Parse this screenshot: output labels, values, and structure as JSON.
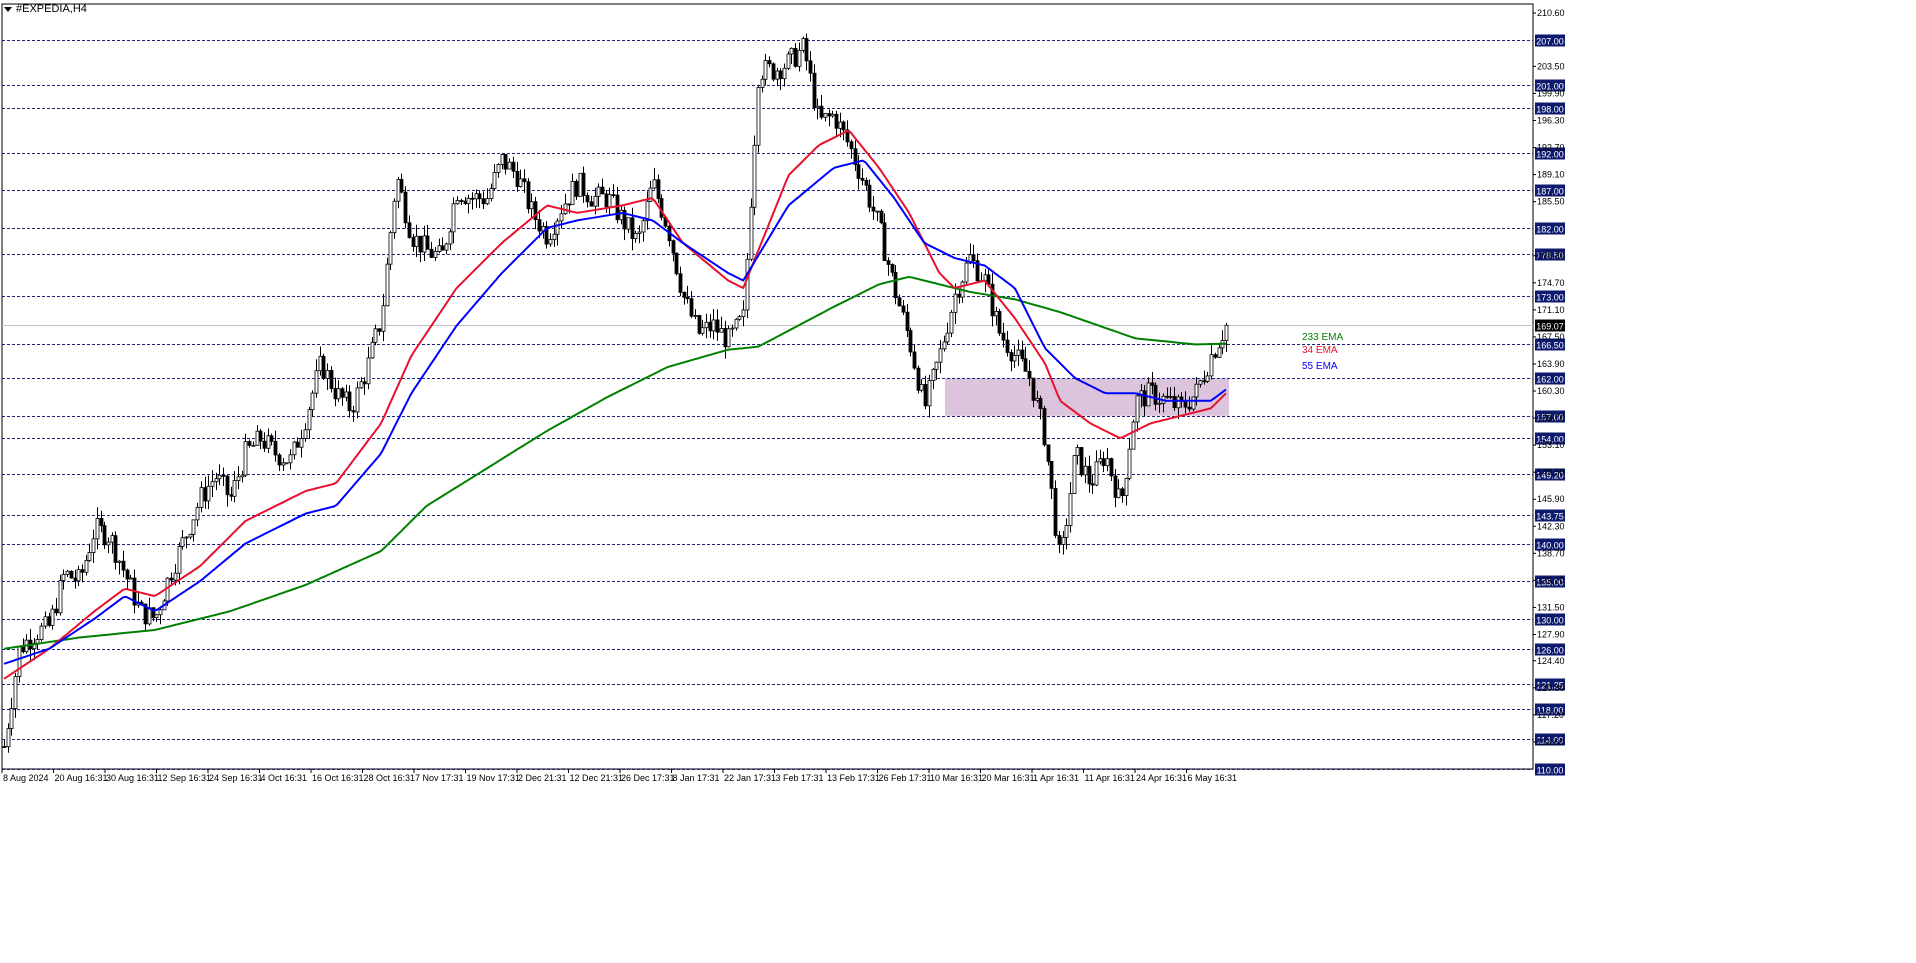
{
  "title": "#EXPEDIA,H4",
  "colors": {
    "background": "#ffffff",
    "candle": "#000000",
    "grid_dashed": "#1a237e",
    "level_tag_bg": "#0d1a6e",
    "level_tag_text": "#ffffff",
    "ema233": "#008000",
    "ema34": "#e8112d",
    "ema55": "#0000ff",
    "zone": "#d8bfd8",
    "current_line": "#c0c0c0"
  },
  "chart_data": {
    "type": "candlestick",
    "symbol": "#EXPEDIA",
    "timeframe": "H4",
    "ylim": [
      110.0,
      211.8
    ],
    "x_ticks": [
      "8 Aug 2024",
      "20 Aug 16:31",
      "30 Aug 16:31",
      "12 Sep 16:31",
      "24 Sep 16:31",
      "4 Oct 16:31",
      "16 Oct 16:31",
      "28 Oct 16:31",
      "7 Nov 17:31",
      "19 Nov 17:31",
      "2 Dec 21:31",
      "12 Dec 21:31",
      "26 Dec 17:31",
      "8 Jan 17:31",
      "22 Jan 17:31",
      "3 Feb 17:31",
      "13 Feb 17:31",
      "26 Feb 17:31",
      "10 Mar 16:31",
      "20 Mar 16:31",
      "1 Apr 16:31",
      "11 Apr 16:31",
      "24 Apr 16:31",
      "6 May 16:31"
    ],
    "y_scale_ticks": [
      "210.60",
      "203.50",
      "199.90",
      "196.30",
      "192.70",
      "189.10",
      "185.50",
      "178.30",
      "174.70",
      "171.10",
      "167.50",
      "163.90",
      "160.30",
      "156.70",
      "153.10",
      "149.50",
      "145.90",
      "142.30",
      "138.70",
      "135.10",
      "131.50",
      "127.90",
      "124.40",
      "120.80",
      "117.20",
      "113.60"
    ],
    "levels": [
      "207.00",
      "201.00",
      "198.00",
      "192.00",
      "187.00",
      "182.00",
      "178.50",
      "173.00",
      "166.50",
      "162.00",
      "157.00",
      "154.00",
      "149.20",
      "143.75",
      "140.00",
      "135.00",
      "130.00",
      "126.00",
      "121.25",
      "118.00",
      "114.00",
      "110.00"
    ],
    "current_price": "169.07",
    "support_zone": {
      "low": 157.0,
      "high": 162.0,
      "x_start": "10 Mar 16:31",
      "x_end": "6 May 16:31"
    },
    "legend": [
      {
        "name": "233 EMA",
        "color": "#008000"
      },
      {
        "name": "34 EMA",
        "color": "#e8112d"
      },
      {
        "name": "55 EMA",
        "color": "#0000ff"
      }
    ],
    "price_path": [
      [
        0,
        113
      ],
      [
        1,
        126
      ],
      [
        2,
        128
      ],
      [
        3,
        129
      ],
      [
        4,
        136
      ],
      [
        5,
        135
      ],
      [
        6,
        142
      ],
      [
        7,
        141
      ],
      [
        8,
        136
      ],
      [
        9,
        131
      ],
      [
        10,
        130
      ],
      [
        11,
        136
      ],
      [
        12,
        141
      ],
      [
        13,
        146
      ],
      [
        14,
        149
      ],
      [
        15,
        146
      ],
      [
        16,
        152
      ],
      [
        17,
        154
      ],
      [
        18,
        152
      ],
      [
        19,
        151
      ],
      [
        20,
        157
      ],
      [
        21,
        164
      ],
      [
        22,
        160
      ],
      [
        23,
        158
      ],
      [
        24,
        163
      ],
      [
        25,
        170
      ],
      [
        26,
        189
      ],
      [
        27,
        181
      ],
      [
        28,
        179
      ],
      [
        29,
        178
      ],
      [
        30,
        187
      ],
      [
        31,
        186
      ],
      [
        32,
        186
      ],
      [
        33,
        191
      ],
      [
        34,
        189
      ],
      [
        35,
        184
      ],
      [
        36,
        181
      ],
      [
        37,
        185
      ],
      [
        38,
        188
      ],
      [
        39,
        186
      ],
      [
        40,
        186
      ],
      [
        41,
        183
      ],
      [
        42,
        180
      ],
      [
        43,
        188
      ],
      [
        44,
        182
      ],
      [
        45,
        173
      ],
      [
        46,
        168
      ],
      [
        47,
        169
      ],
      [
        48,
        167
      ],
      [
        49,
        170
      ],
      [
        50,
        203
      ],
      [
        51,
        203
      ],
      [
        52,
        204
      ],
      [
        53,
        206
      ],
      [
        54,
        196
      ],
      [
        55,
        197
      ],
      [
        56,
        193
      ],
      [
        57,
        188
      ],
      [
        58,
        182
      ],
      [
        59,
        174
      ],
      [
        60,
        167
      ],
      [
        61,
        158
      ],
      [
        62,
        165
      ],
      [
        63,
        173
      ],
      [
        64,
        178
      ],
      [
        65,
        175
      ],
      [
        66,
        168
      ],
      [
        67,
        165
      ],
      [
        68,
        162
      ],
      [
        69,
        154
      ],
      [
        70,
        137
      ],
      [
        71,
        152
      ],
      [
        72,
        148
      ],
      [
        73,
        152
      ],
      [
        74,
        145
      ],
      [
        75,
        159
      ],
      [
        76,
        160
      ],
      [
        77,
        159
      ],
      [
        78,
        158
      ],
      [
        79,
        160
      ],
      [
        80,
        165
      ],
      [
        81,
        169
      ]
    ],
    "ema233_path": [
      [
        0,
        126
      ],
      [
        5,
        127.5
      ],
      [
        10,
        128.5
      ],
      [
        15,
        131
      ],
      [
        20,
        134.5
      ],
      [
        25,
        139
      ],
      [
        28,
        145
      ],
      [
        32,
        150
      ],
      [
        36,
        155
      ],
      [
        40,
        159.5
      ],
      [
        44,
        163.5
      ],
      [
        48,
        165.8
      ],
      [
        50,
        166.2
      ],
      [
        55,
        171.5
      ],
      [
        58,
        174.5
      ],
      [
        60,
        175.5
      ],
      [
        64,
        173.5
      ],
      [
        67,
        172.5
      ],
      [
        70,
        170.8
      ],
      [
        75,
        167.3
      ],
      [
        79,
        166.5
      ],
      [
        81,
        166.6
      ]
    ],
    "ema34_path": [
      [
        0,
        122
      ],
      [
        3,
        126
      ],
      [
        6,
        131
      ],
      [
        8,
        134
      ],
      [
        10,
        133
      ],
      [
        13,
        137
      ],
      [
        16,
        143
      ],
      [
        20,
        147
      ],
      [
        22,
        148
      ],
      [
        25,
        156
      ],
      [
        27,
        165
      ],
      [
        30,
        174
      ],
      [
        33,
        180
      ],
      [
        36,
        185
      ],
      [
        38,
        184
      ],
      [
        41,
        185
      ],
      [
        43,
        186
      ],
      [
        45,
        180
      ],
      [
        48,
        175
      ],
      [
        49,
        174
      ],
      [
        52,
        189
      ],
      [
        54,
        193
      ],
      [
        56,
        195
      ],
      [
        58,
        190
      ],
      [
        60,
        184
      ],
      [
        62,
        176
      ],
      [
        63,
        174
      ],
      [
        65,
        175
      ],
      [
        67,
        170
      ],
      [
        69,
        164
      ],
      [
        70,
        159
      ],
      [
        72,
        156
      ],
      [
        74,
        154
      ],
      [
        76,
        156
      ],
      [
        78,
        157
      ],
      [
        80,
        158
      ],
      [
        81,
        160
      ]
    ],
    "ema55_path": [
      [
        0,
        124
      ],
      [
        3,
        126
      ],
      [
        6,
        130
      ],
      [
        8,
        133
      ],
      [
        10,
        131
      ],
      [
        13,
        135
      ],
      [
        16,
        140
      ],
      [
        20,
        144
      ],
      [
        22,
        145
      ],
      [
        25,
        152
      ],
      [
        27,
        160
      ],
      [
        30,
        169
      ],
      [
        33,
        176
      ],
      [
        36,
        182
      ],
      [
        38,
        183
      ],
      [
        41,
        184
      ],
      [
        43,
        183
      ],
      [
        45,
        180
      ],
      [
        48,
        176
      ],
      [
        49,
        175
      ],
      [
        52,
        185
      ],
      [
        55,
        190
      ],
      [
        57,
        191
      ],
      [
        59,
        186
      ],
      [
        61,
        180
      ],
      [
        63,
        178
      ],
      [
        65,
        177
      ],
      [
        67,
        174
      ],
      [
        69,
        166
      ],
      [
        71,
        162
      ],
      [
        73,
        160
      ],
      [
        75,
        160
      ],
      [
        77,
        159
      ],
      [
        80,
        159
      ],
      [
        81,
        160.5
      ]
    ]
  }
}
